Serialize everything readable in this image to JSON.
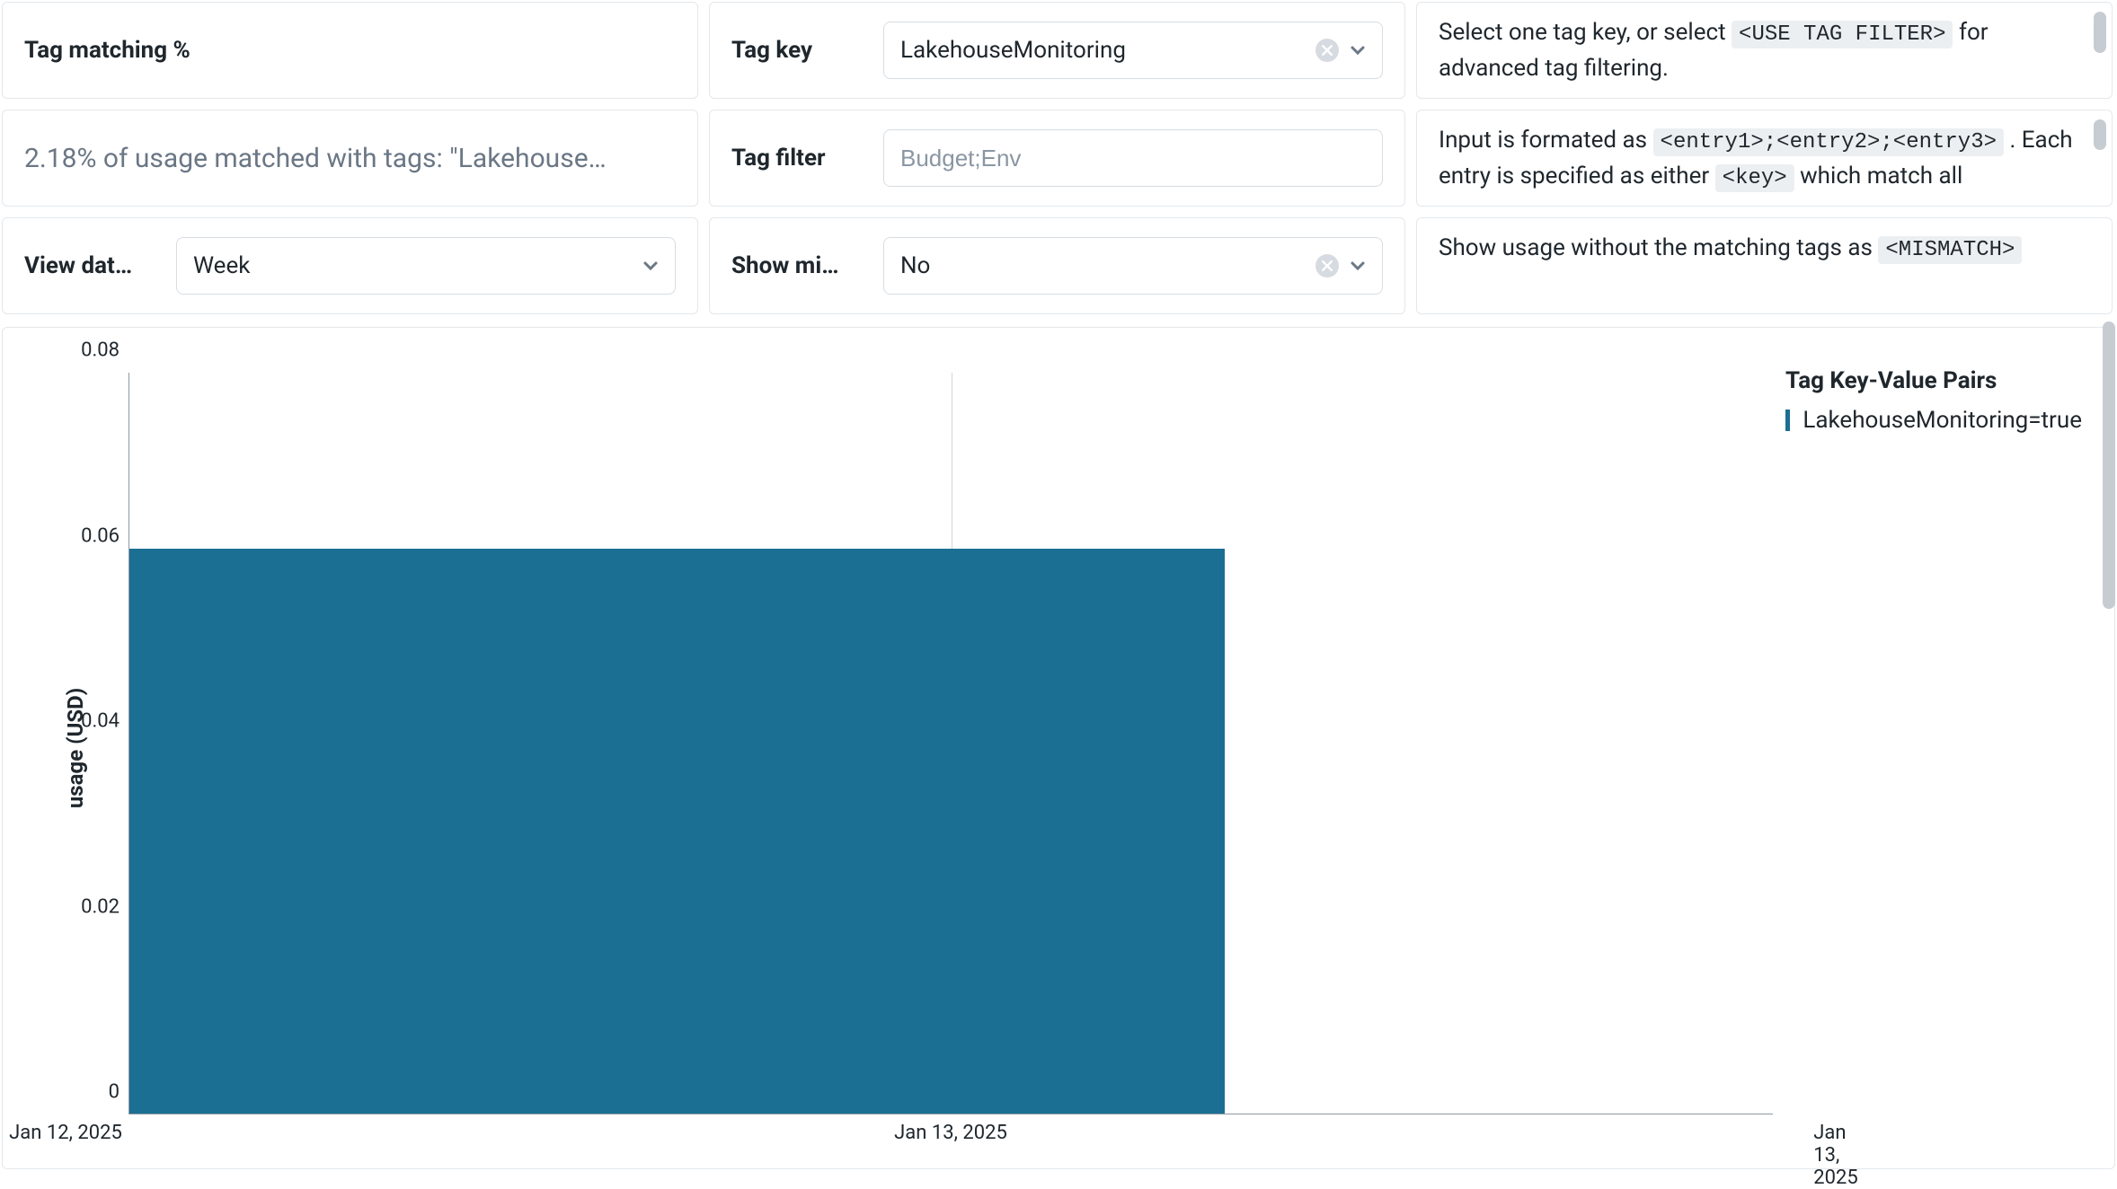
{
  "filters": {
    "tag_matching_title": "Tag matching %",
    "tag_matching_stat": "2.18% of usage matched with tags: \"Lakehouse…",
    "view_data_by": {
      "label": "View dat…",
      "value": "Week"
    },
    "tag_key": {
      "label": "Tag key",
      "value": "LakehouseMonitoring"
    },
    "tag_filter": {
      "label": "Tag filter",
      "placeholder": "Budget;Env"
    },
    "show_mismatch": {
      "label": "Show mi…",
      "value": "No"
    }
  },
  "help": {
    "row1_pre": "Select one tag key, or select ",
    "row1_code": "<USE TAG FILTER>",
    "row1_post": " for advanced tag filtering.",
    "row2_pre": "Input is formated as ",
    "row2_code1": "<entry1>;<entry2>;<entry3>",
    "row2_mid": " . Each entry is specified as either ",
    "row2_code2": "<key>",
    "row2_post": " which match all",
    "row3_pre": "Show usage without the matching tags as ",
    "row3_code": "<MISMATCH>"
  },
  "chart_data": {
    "type": "bar",
    "ylabel": "usage (USD)",
    "ylim": [
      0,
      0.08
    ],
    "yticks": [
      0,
      0.02,
      0.04,
      0.06,
      0.08
    ],
    "categories": [
      "Jan 12, 2025",
      "Jan 13, 2025",
      "Jan 13, 2025"
    ],
    "series": [
      {
        "name": "LakehouseMonitoring=true",
        "values": [
          0.061,
          0.061,
          null
        ]
      }
    ],
    "legend_title": "Tag Key-Value Pairs",
    "color": "#1b6f92"
  }
}
